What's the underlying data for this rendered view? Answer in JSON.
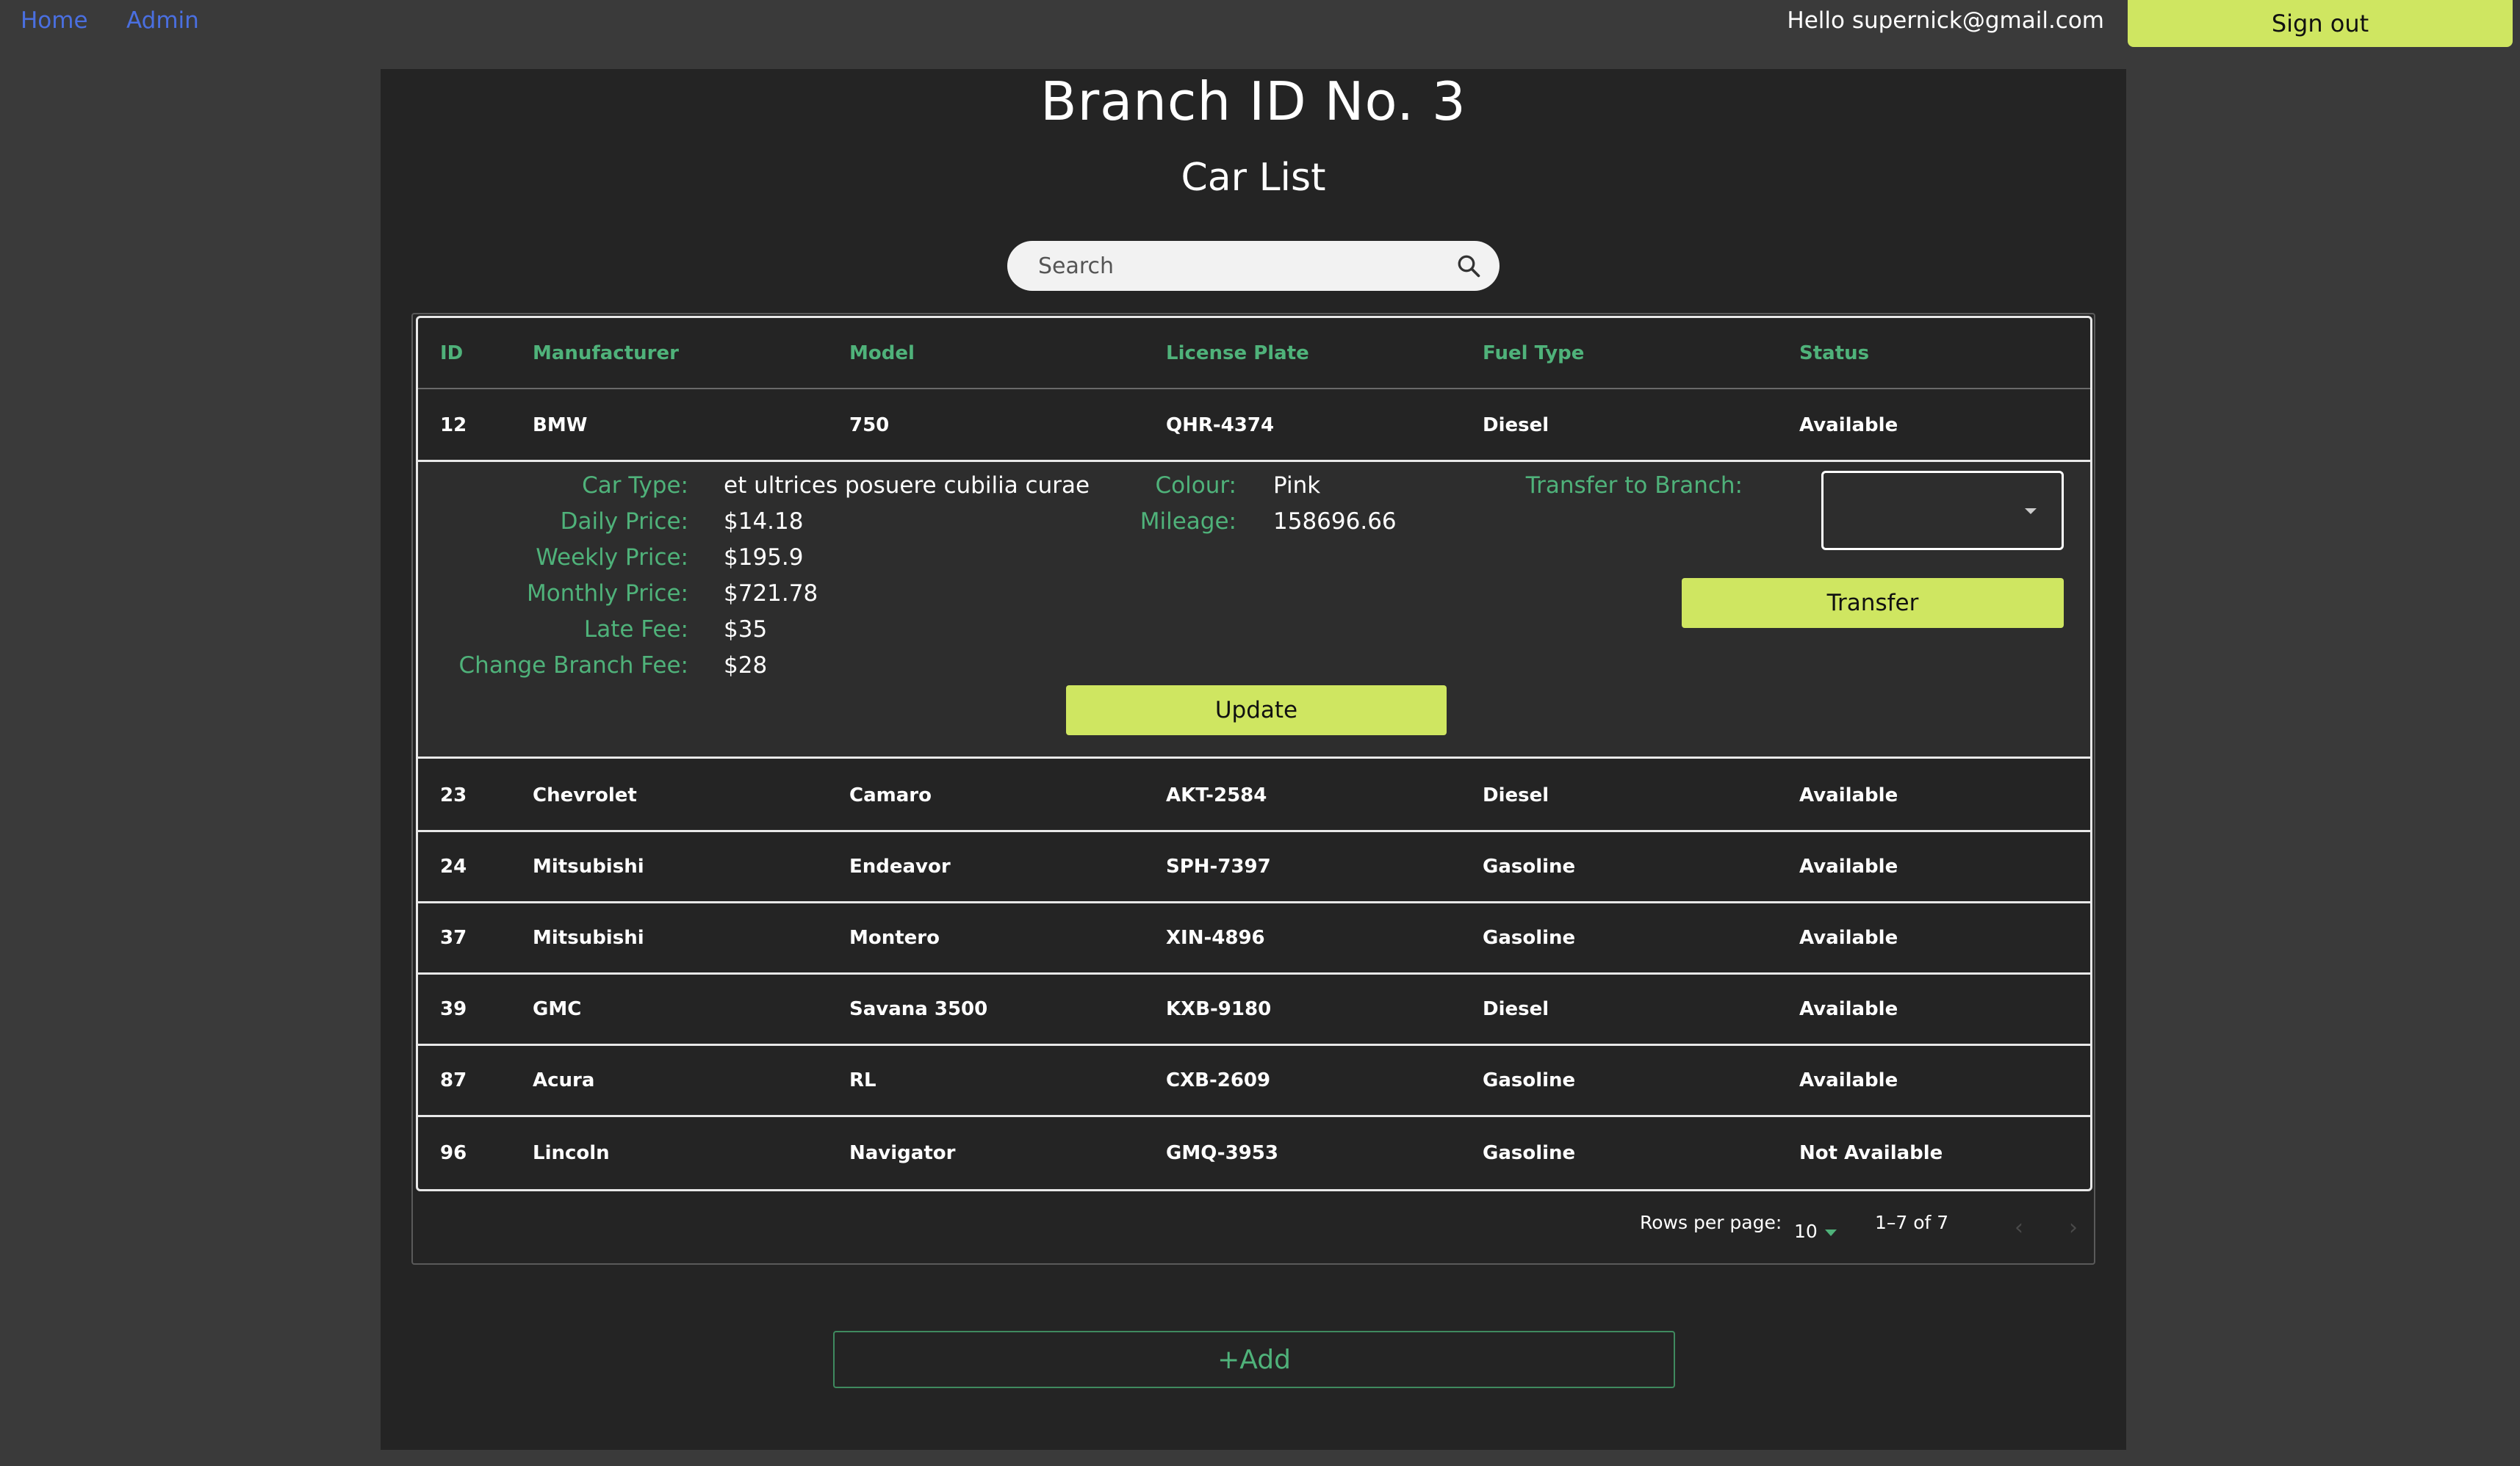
{
  "nav": {
    "home": "Home",
    "admin": "Admin",
    "hello": "Hello supernick@gmail.com",
    "signout": "Sign out"
  },
  "page": {
    "title": "Branch ID No. 3",
    "subtitle": "Car List"
  },
  "search": {
    "placeholder": "Search"
  },
  "table": {
    "headers": [
      "ID",
      "Manufacturer",
      "Model",
      "License Plate",
      "Fuel Type",
      "Status"
    ],
    "rows": [
      [
        "12",
        "BMW",
        "750",
        "QHR-4374",
        "Diesel",
        "Available"
      ],
      [
        "23",
        "Chevrolet",
        "Camaro",
        "AKT-2584",
        "Diesel",
        "Available"
      ],
      [
        "24",
        "Mitsubishi",
        "Endeavor",
        "SPH-7397",
        "Gasoline",
        "Available"
      ],
      [
        "37",
        "Mitsubishi",
        "Montero",
        "XIN-4896",
        "Gasoline",
        "Available"
      ],
      [
        "39",
        "GMC",
        "Savana 3500",
        "KXB-9180",
        "Diesel",
        "Available"
      ],
      [
        "87",
        "Acura",
        "RL",
        "CXB-2609",
        "Gasoline",
        "Available"
      ],
      [
        "96",
        "Lincoln",
        "Navigator",
        "GMQ-3953",
        "Gasoline",
        "Not Available"
      ]
    ]
  },
  "detail": {
    "car_type_label": "Car Type:",
    "car_type": "et ultrices posuere cubilia curae",
    "daily_label": "Daily Price:",
    "daily": "$14.18",
    "weekly_label": "Weekly Price:",
    "weekly": "$195.9",
    "monthly_label": "Monthly Price:",
    "monthly": "$721.78",
    "late_label": "Late Fee:",
    "late": "$35",
    "branch_fee_label": "Change Branch Fee:",
    "branch_fee": "$28",
    "colour_label": "Colour:",
    "colour": "Pink",
    "mileage_label": "Mileage:",
    "mileage": "158696.66",
    "transfer_label": "Transfer to Branch:",
    "transfer_button": "Transfer",
    "update_button": "Update"
  },
  "pager": {
    "rows_per_page_label": "Rows per page:",
    "rows_per_page": "10",
    "range": "1–7 of 7",
    "prev": "‹",
    "next": "›"
  },
  "add_button": "+Add",
  "colors": {
    "accent": "#cfe661",
    "green": "#4fb27a",
    "panel": "#242424",
    "bg": "#3a3a3a"
  }
}
